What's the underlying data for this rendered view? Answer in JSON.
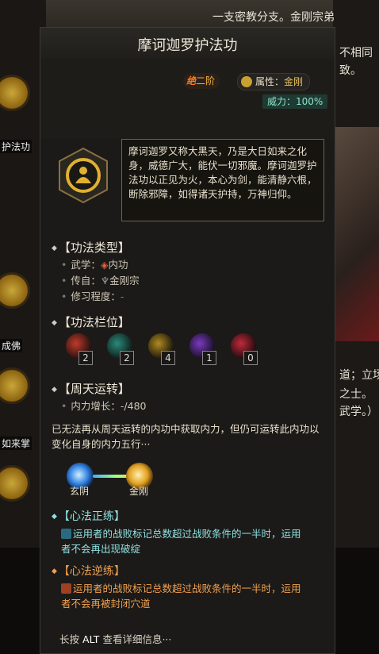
{
  "background": {
    "top_right_lines": [
      "一支密教分支。金刚宗弟",
      "不相同",
      "致。"
    ],
    "right_lines": [
      "道；立场",
      "之士。",
      "武学。）"
    ],
    "left_items": [
      {
        "label": "护法功",
        "icon": "skill-icon"
      },
      {
        "label": "成佛",
        "icon": "skill-icon"
      },
      {
        "label": "如来掌",
        "icon": "skill-icon"
      },
      {
        "label": "",
        "icon": "skill-icon"
      }
    ]
  },
  "skill": {
    "name": "摩诃迦罗护法功",
    "tier_prefix": "绝",
    "tier": "二阶",
    "attribute_label": "属性：",
    "attribute_value": "金刚",
    "power_label": "威力：",
    "power_value": "100%",
    "description": "摩诃迦罗又称大黑天，乃是大日如来之化身，威德广大，能伏一切邪魔。摩诃迦罗护法功以正见为火，本心为剑，能清静六根，断除邪障，如得诸天护持，万神归仰。",
    "type_section": {
      "title": "【功法类型】",
      "martial_label": "武学：",
      "martial_value": "内功",
      "origin_label": "传自：",
      "origin_value": "金刚宗",
      "practice_label": "修习程度：",
      "practice_value": "-"
    },
    "slot_section": {
      "title": "【功法栏位】",
      "slots": [
        {
          "count": "2",
          "color": "#c03a2a"
        },
        {
          "count": "2",
          "color": "#2a8a7a"
        },
        {
          "count": "4",
          "color": "#b08a20"
        },
        {
          "count": "1",
          "color": "#7a3ac0"
        },
        {
          "count": "0",
          "color": "#c02a3a"
        }
      ]
    },
    "cycle_section": {
      "title": "【周天运转】",
      "growth_label": "内力增长：",
      "growth_value": "-/480",
      "note": "已无法再从周天运转的内功中获取内力，但仍可运转此内功以变化自身的内力五行···",
      "elements": [
        "玄阴",
        "金刚"
      ]
    },
    "zheng": {
      "title": "【心法正练】",
      "text": "运用者的战败标记总数超过战败条件的一半时，运用者不会再出现破绽"
    },
    "ni": {
      "title": "【心法逆练】",
      "text": "运用者的战败标记总数超过战败条件的一半时，运用者不会再被封闭穴道"
    },
    "footer": {
      "prefix": "长按",
      "key": "ALT",
      "suffix": "查看详细信息···"
    }
  }
}
